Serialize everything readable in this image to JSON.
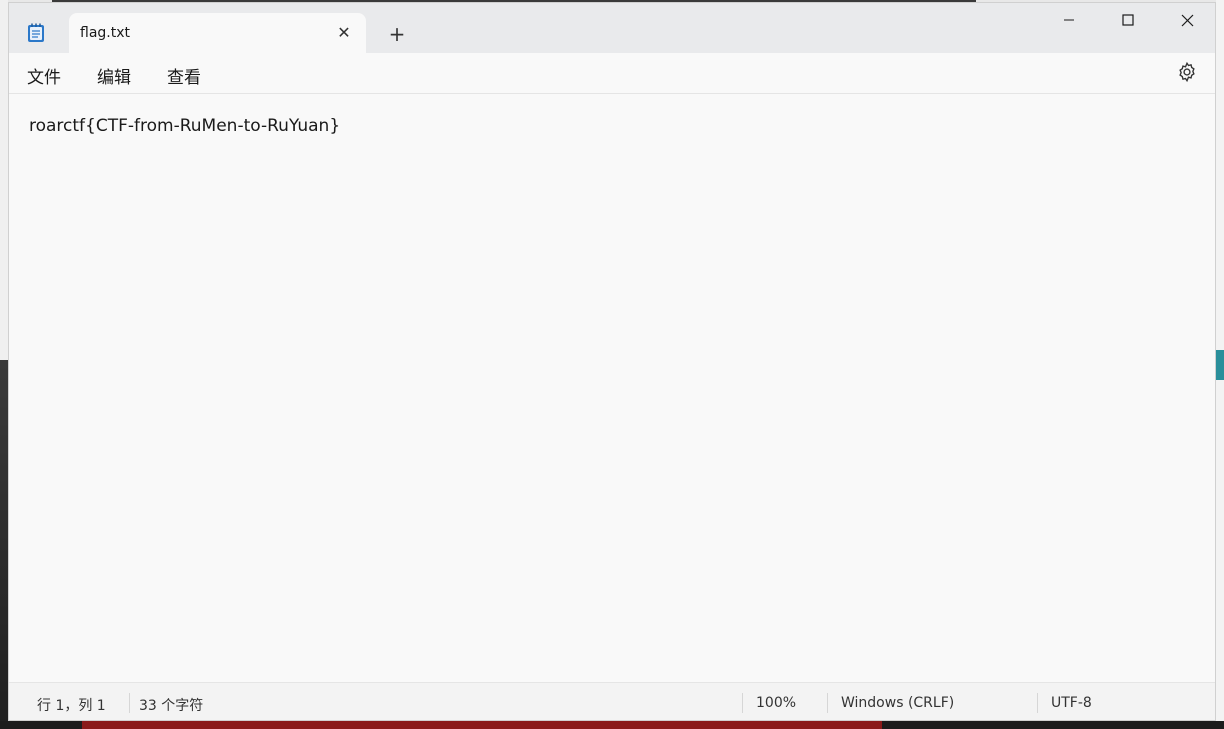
{
  "tab": {
    "title": "flag.txt",
    "close_symbol": "✕",
    "new_tab_symbol": "+"
  },
  "menu": {
    "file": "文件",
    "edit": "编辑",
    "view": "查看"
  },
  "editor": {
    "content": "roarctf{CTF-from-RuMen-to-RuYuan}"
  },
  "status": {
    "position": "行 1，列 1",
    "char_count": "33 个字符",
    "zoom": "100%",
    "line_ending": "Windows (CRLF)",
    "encoding": "UTF-8"
  },
  "icons": {
    "app": "notepad-icon",
    "settings": "gear-icon",
    "minimize": "minimize-icon",
    "maximize": "maximize-icon",
    "close": "close-icon"
  },
  "colors": {
    "accent": "#2b78c9",
    "window_bg": "#f9f9f9",
    "titlebar_bg": "#e9eaec"
  }
}
